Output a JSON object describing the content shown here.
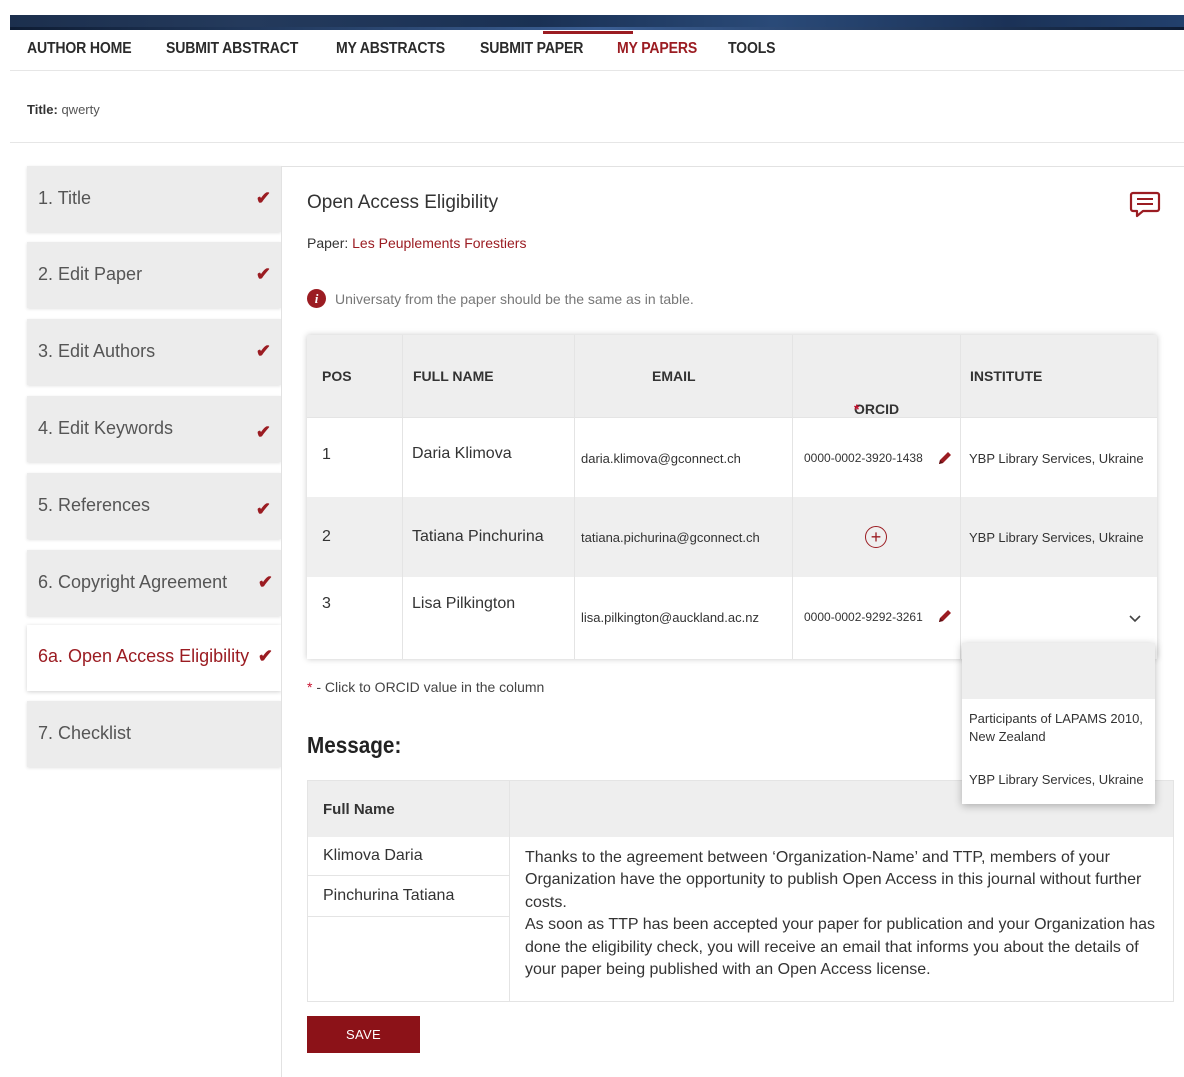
{
  "nav": {
    "items": [
      {
        "label": "AUTHOR HOME"
      },
      {
        "label": "SUBMIT ABSTRACT"
      },
      {
        "label": "MY ABSTRACTS"
      },
      {
        "label": "SUBMIT PAPER"
      },
      {
        "label": "MY PAPERS"
      },
      {
        "label": "TOOLS"
      }
    ],
    "active_index": 4
  },
  "page": {
    "title_label": "Title:",
    "title_value": "qwerty"
  },
  "sidebar": {
    "items": [
      {
        "label": "1. Title",
        "checked": true
      },
      {
        "label": "2. Edit Paper",
        "checked": true
      },
      {
        "label": "3. Edit Authors",
        "checked": true
      },
      {
        "label": "4. Edit Keywords",
        "checked": true
      },
      {
        "label": "5. References",
        "checked": true
      },
      {
        "label": "6. Copyright Agreement",
        "checked": true
      },
      {
        "label": "6a. Open Access Eligibility",
        "checked": true,
        "active": true
      },
      {
        "label": "7. Checklist",
        "checked": false
      }
    ],
    "check_glyph": "✔"
  },
  "main": {
    "heading": "Open Access Eligibility",
    "paper_label": "Paper:",
    "paper_name": "Les Peuplements Forestiers",
    "info_text": "Universaty from the paper should be the same as in table.",
    "table": {
      "headers": [
        "POS",
        "FULL NAME",
        "EMAIL",
        "ORCID",
        "INSTITUTE"
      ],
      "required_mark": "*",
      "rows": [
        {
          "pos": "1",
          "name": "Daria Klimova",
          "email": "daria.klimova@gconnect.ch",
          "orcid": "0000-0002-3920-1438",
          "institute": "YBP Library Services, Ukraine"
        },
        {
          "pos": "2",
          "name": "Tatiana Pinchurina",
          "email": "tatiana.pichurina@gconnect.ch",
          "orcid": "",
          "institute": "YBP Library Services, Ukraine"
        },
        {
          "pos": "3",
          "name": "Lisa Pilkington",
          "email": "lisa.pilkington@auckland.ac.nz",
          "orcid": "0000-0002-9292-3261",
          "institute": ""
        }
      ]
    },
    "footnote_star": "*",
    "footnote_text": " - Click to ORCID value in the column",
    "message_title": "Message:",
    "message": {
      "header": "Full Name",
      "names": [
        "Klimova Daria",
        "Pinchurina Tatiana"
      ],
      "paragraph1": "Thanks to the agreement between ‘Organization-Name’ and TTP, members of your Organization have the opportunity to publish Open Access in this journal without further costs.",
      "paragraph2": "As soon as TTP  has been accepted your paper for publication and your Organization has done the eligibility check, you will receive an email that informs you about the details of your paper being published with an Open Access license."
    },
    "save_label": "SAVE"
  },
  "institute_dropdown": {
    "options": [
      "Participants of LAPAMS 2010, New Zealand",
      "YBP Library Services, Ukraine"
    ]
  },
  "colors": {
    "accent": "#9b1c22",
    "button": "#8c1218"
  }
}
